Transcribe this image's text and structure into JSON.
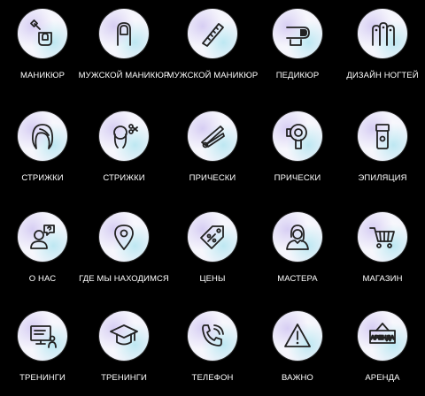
{
  "tiles": [
    {
      "label": "МАНИКЮР",
      "icon": "nail-polish-hand-icon"
    },
    {
      "label": "МУЖСКОЙ МАНИКЮР",
      "icon": "nail-icon"
    },
    {
      "label": "МУЖСКОЙ МАНИКЮР",
      "icon": "nail-file-icon"
    },
    {
      "label": "ПЕДИКЮР",
      "icon": "toe-icon"
    },
    {
      "label": "ДИЗАЙН НОГТЕЙ",
      "icon": "nail-design-icon"
    },
    {
      "label": "СТРИЖКИ",
      "icon": "hair-icon"
    },
    {
      "label": "СТРИЖКИ",
      "icon": "haircut-scissors-icon"
    },
    {
      "label": "ПРИЧЕСКИ",
      "icon": "hair-straightener-icon"
    },
    {
      "label": "ПРИЧЕСКИ",
      "icon": "hair-dryer-icon"
    },
    {
      "label": "ЭПИЛЯЦИЯ",
      "icon": "epilator-icon"
    },
    {
      "label": "О НАС",
      "icon": "person-question-icon"
    },
    {
      "label": "ГДЕ МЫ НАХОДИМСЯ",
      "icon": "map-pin-icon"
    },
    {
      "label": "ЦЕНЫ",
      "icon": "price-tag-icon"
    },
    {
      "label": "МАСТЕРА",
      "icon": "woman-icon"
    },
    {
      "label": "МАГАЗИН",
      "icon": "shopping-cart-icon"
    },
    {
      "label": "ТРЕНИНГИ",
      "icon": "training-screen-icon"
    },
    {
      "label": "ТРЕНИНГИ",
      "icon": "graduation-cap-icon"
    },
    {
      "label": "ТЕЛЕФОН",
      "icon": "phone-icon"
    },
    {
      "label": "ВАЖНО",
      "icon": "warning-icon"
    },
    {
      "label": "АРЕНДА",
      "icon": "rent-sign-icon"
    }
  ],
  "rent_sign_text": "АРЕНДА"
}
